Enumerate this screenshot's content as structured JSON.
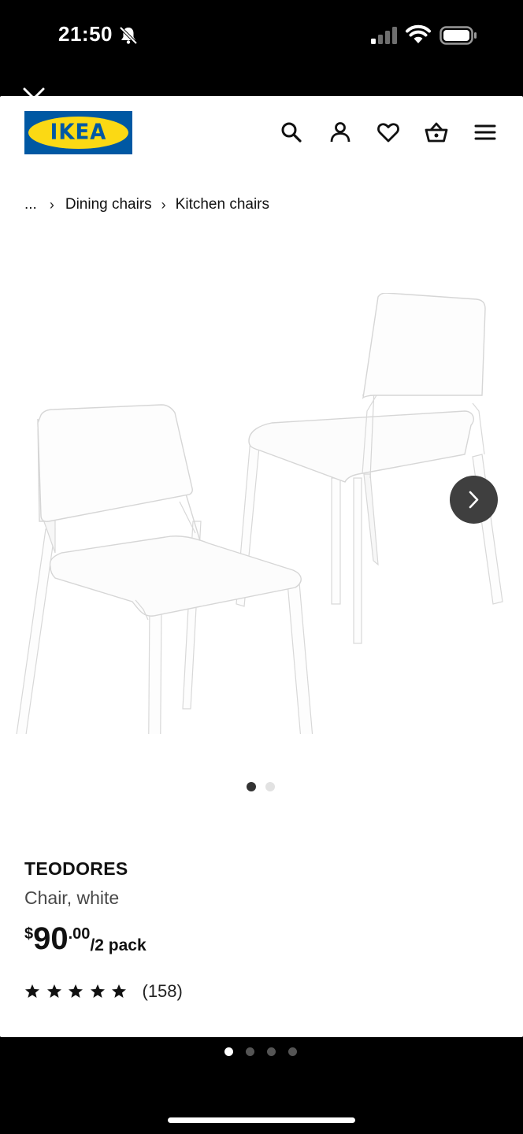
{
  "status_bar": {
    "time": "21:50",
    "icons": [
      "bell-slash-icon",
      "cellular-signal-icon",
      "wifi-icon",
      "battery-icon"
    ]
  },
  "header": {
    "logo_text": "IKEA",
    "icons": [
      "search-icon",
      "user-icon",
      "heart-icon",
      "basket-icon",
      "menu-icon"
    ],
    "colors": {
      "brand_blue": "#0058a3",
      "brand_yellow": "#fbd914"
    }
  },
  "breadcrumb": {
    "ellipsis": "...",
    "items": [
      "Dining chairs",
      "Kitchen chairs"
    ]
  },
  "carousel": {
    "image_count": 2,
    "active_index": 0
  },
  "product": {
    "name": "TEODORES",
    "description": "Chair, white",
    "price": {
      "currency": "$",
      "integer": "90",
      "decimal": ".00",
      "unit": "/2 pack"
    },
    "rating": {
      "stars": 5,
      "max_stars": 5,
      "count": "(158)"
    }
  },
  "page_indicator": {
    "pages": 4,
    "active_index": 0
  }
}
